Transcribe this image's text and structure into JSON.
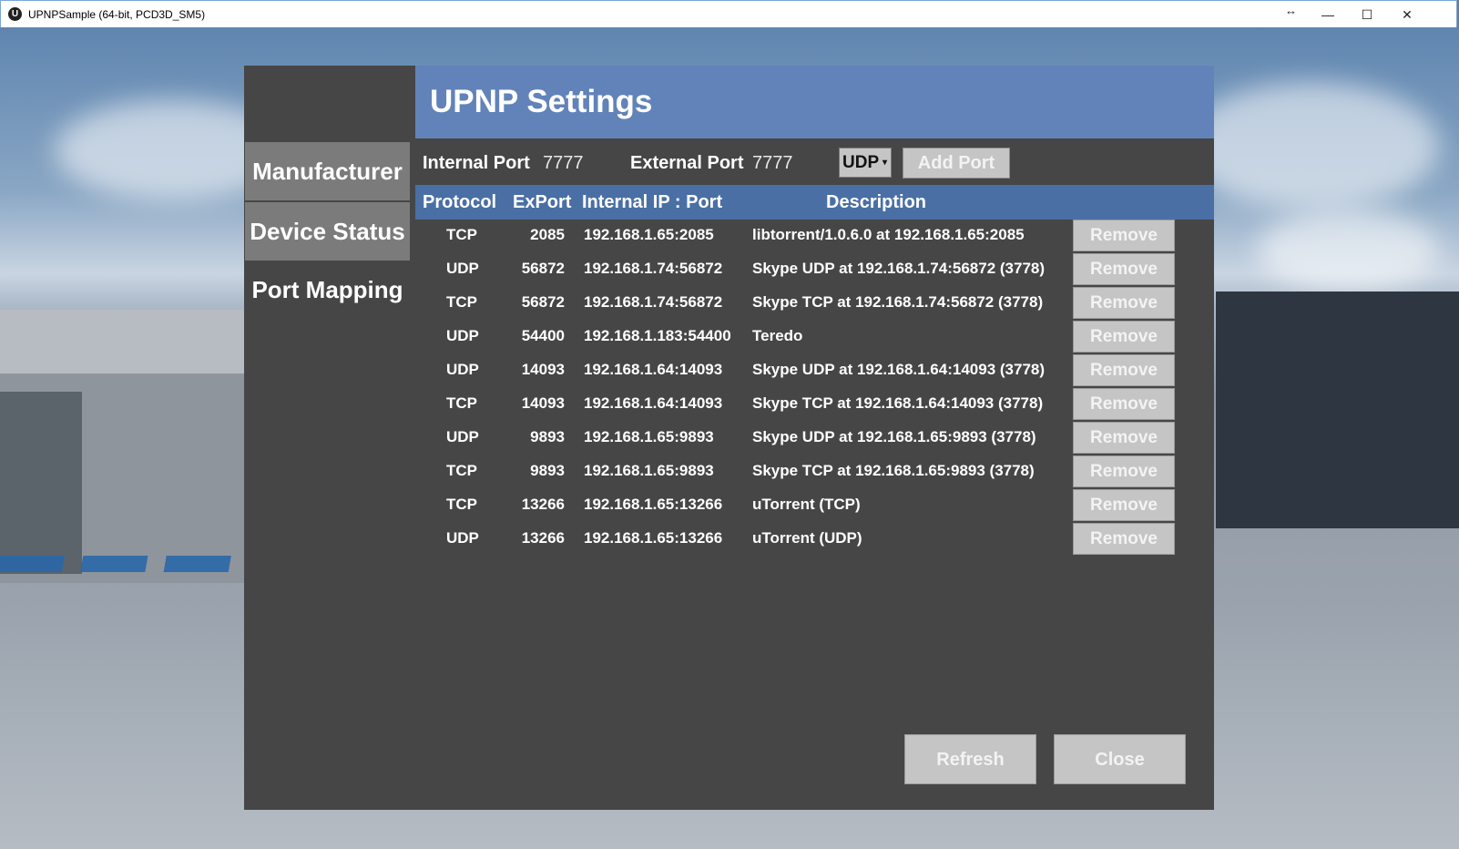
{
  "window": {
    "title": "UPNPSample (64-bit, PCD3D_SM5)",
    "app_icon_glyph": "U",
    "resize_glyph": "↔",
    "minimize_glyph": "—",
    "maximize_glyph": "☐",
    "close_glyph": "✕"
  },
  "dialog": {
    "title": "UPNP Settings",
    "nav": {
      "manufacturer": "Manufacturer",
      "device_status": "Device Status",
      "port_mapping": "Port Mapping"
    },
    "ports": {
      "internal_label": "Internal Port",
      "internal_value": "7777",
      "external_label": "External Port",
      "external_value": "7777",
      "protocol_selected": "UDP",
      "add_port_label": "Add Port"
    },
    "table": {
      "headers": {
        "protocol": "Protocol",
        "export": "ExPort",
        "ip": "Internal IP : Port",
        "description": "Description"
      },
      "rows": [
        {
          "protocol": "TCP",
          "export": "2085",
          "ip": "192.168.1.65:2085",
          "description": "libtorrent/1.0.6.0 at 192.168.1.65:2085",
          "action": "Remove"
        },
        {
          "protocol": "UDP",
          "export": "56872",
          "ip": "192.168.1.74:56872",
          "description": "Skype UDP at 192.168.1.74:56872 (3778)",
          "action": "Remove"
        },
        {
          "protocol": "TCP",
          "export": "56872",
          "ip": "192.168.1.74:56872",
          "description": "Skype TCP at 192.168.1.74:56872 (3778)",
          "action": "Remove"
        },
        {
          "protocol": "UDP",
          "export": "54400",
          "ip": "192.168.1.183:54400",
          "description": "Teredo",
          "action": "Remove"
        },
        {
          "protocol": "UDP",
          "export": "14093",
          "ip": "192.168.1.64:14093",
          "description": "Skype UDP at 192.168.1.64:14093 (3778)",
          "action": "Remove"
        },
        {
          "protocol": "TCP",
          "export": "14093",
          "ip": "192.168.1.64:14093",
          "description": "Skype TCP at 192.168.1.64:14093 (3778)",
          "action": "Remove"
        },
        {
          "protocol": "UDP",
          "export": "9893",
          "ip": "192.168.1.65:9893",
          "description": "Skype UDP at 192.168.1.65:9893 (3778)",
          "action": "Remove"
        },
        {
          "protocol": "TCP",
          "export": "9893",
          "ip": "192.168.1.65:9893",
          "description": "Skype TCP at 192.168.1.65:9893 (3778)",
          "action": "Remove"
        },
        {
          "protocol": "TCP",
          "export": "13266",
          "ip": "192.168.1.65:13266",
          "description": "uTorrent (TCP)",
          "action": "Remove"
        },
        {
          "protocol": "UDP",
          "export": "13266",
          "ip": "192.168.1.65:13266",
          "description": "uTorrent (UDP)",
          "action": "Remove"
        }
      ]
    },
    "buttons": {
      "refresh": "Refresh",
      "close": "Close"
    }
  }
}
